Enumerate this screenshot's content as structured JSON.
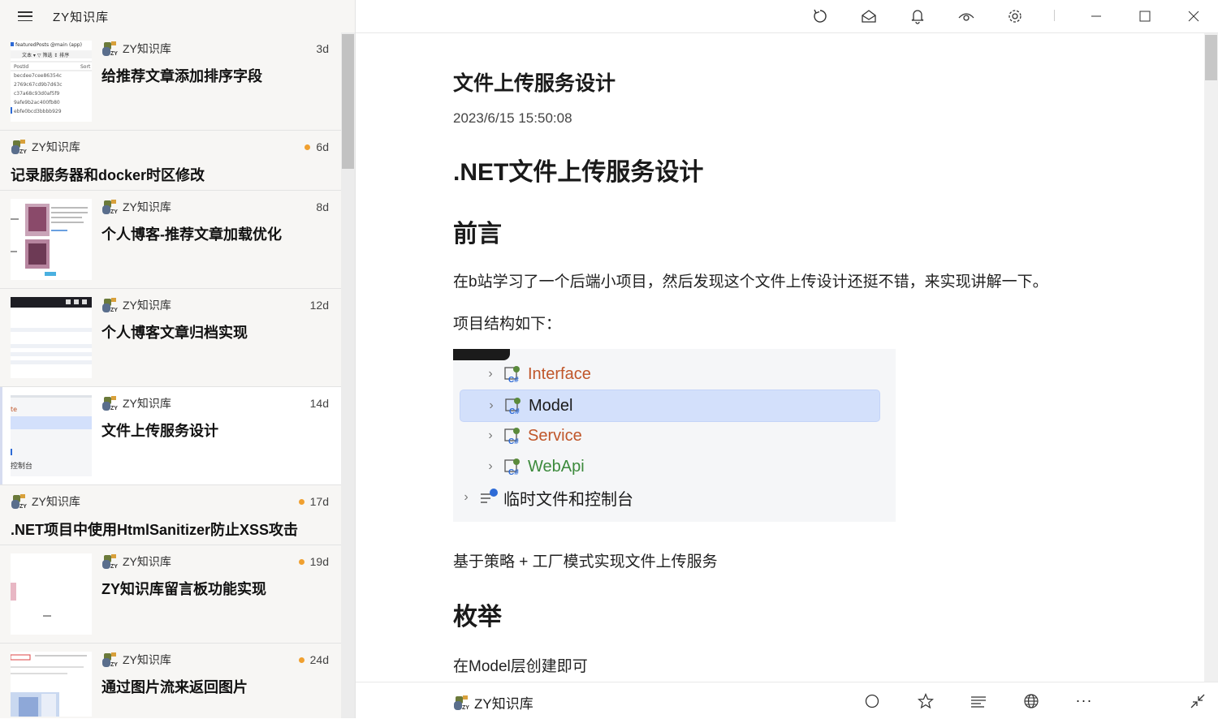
{
  "app": {
    "title": "ZY知识库"
  },
  "colors": {
    "accent_dot": "#f0a030",
    "selection": "#d3e0fb",
    "csharp_green": "#5a8a3c",
    "folder_orange": "#c0562a"
  },
  "feed": [
    {
      "source": "ZY知识库",
      "date": "3d",
      "title": "给推荐文章添加排序字段",
      "unread": false,
      "thumb": "table"
    },
    {
      "source": "ZY知识库",
      "date": "6d",
      "title": "记录服务器和docker时区修改",
      "unread": true,
      "thumb": ""
    },
    {
      "source": "ZY知识库",
      "date": "8d",
      "title": "个人博客-推荐文章加载优化",
      "unread": false,
      "thumb": "anime"
    },
    {
      "source": "ZY知识库",
      "date": "12d",
      "title": "个人博客文章归档实现",
      "unread": false,
      "thumb": "dark"
    },
    {
      "source": "ZY知识库",
      "date": "14d",
      "title": "文件上传服务设计",
      "unread": false,
      "thumb": "tree"
    },
    {
      "source": "ZY知识库",
      "date": "17d",
      "title": ".NET项目中使用HtmlSanitizer防止XSS攻击",
      "unread": true,
      "thumb": ""
    },
    {
      "source": "ZY知识库",
      "date": "19d",
      "title": "ZY知识库留言板功能实现",
      "unread": true,
      "thumb": "blank"
    },
    {
      "source": "ZY知识库",
      "date": "24d",
      "title": "通过图片流来返回图片",
      "unread": true,
      "thumb": "anime2"
    }
  ],
  "thumb_text": {
    "t1_header": "featuredPosts @main (app)",
    "t1_toolbar": "文本 ▾  ▽ 筛选  ↕ 排序",
    "t1_col1": "PostId",
    "t1_col2": "Sort",
    "t1_rows": [
      "becdee7cee86354c",
      "2769c67cd9b7d63c",
      "c37a68c93d0af5f9",
      "9afe9b2ac400fb80",
      "ebfe0bcd3bbbb929"
    ],
    "t5_label": "控制台",
    "t5_prefix": "te"
  },
  "toolbar": {
    "refresh": "refresh-icon",
    "mark_read": "mark-all-read-icon",
    "notify": "bell-icon",
    "view": "eye-icon",
    "settings": "gear-icon",
    "minimize": "minimize-icon",
    "maximize": "maximize-icon",
    "close": "close-icon"
  },
  "article": {
    "title": "文件上传服务设计",
    "date": "2023/6/15 15:50:08",
    "h1": ".NET文件上传服务设计",
    "h2_intro": "前言",
    "p_intro": "在b站学习了一个后端小项目，然后发现这个文件上传设计还挺不错，来实现讲解一下。",
    "p_struct": "项目结构如下：",
    "p_strategy": "基于策略 + 工厂模式实现文件上传服务",
    "h2_enum": "枚举",
    "p_enum": "在Model层创建即可",
    "project_tree": [
      {
        "label": "Interface",
        "color": "#c0562a",
        "selected": false
      },
      {
        "label": "Model",
        "color": "#1a1a1a",
        "selected": true
      },
      {
        "label": "Service",
        "color": "#c0562a",
        "selected": false
      },
      {
        "label": "WebApi",
        "color": "#3c8a3c",
        "selected": false
      },
      {
        "label": "临时文件和控制台",
        "color": "#1a1a1a",
        "selected": false
      }
    ]
  },
  "bottom": {
    "source": "ZY知识库",
    "icons": [
      "circle-icon",
      "star-icon",
      "text-format-icon",
      "globe-icon",
      "more-icon",
      "collapse-icon"
    ],
    "more_glyph": "···"
  }
}
